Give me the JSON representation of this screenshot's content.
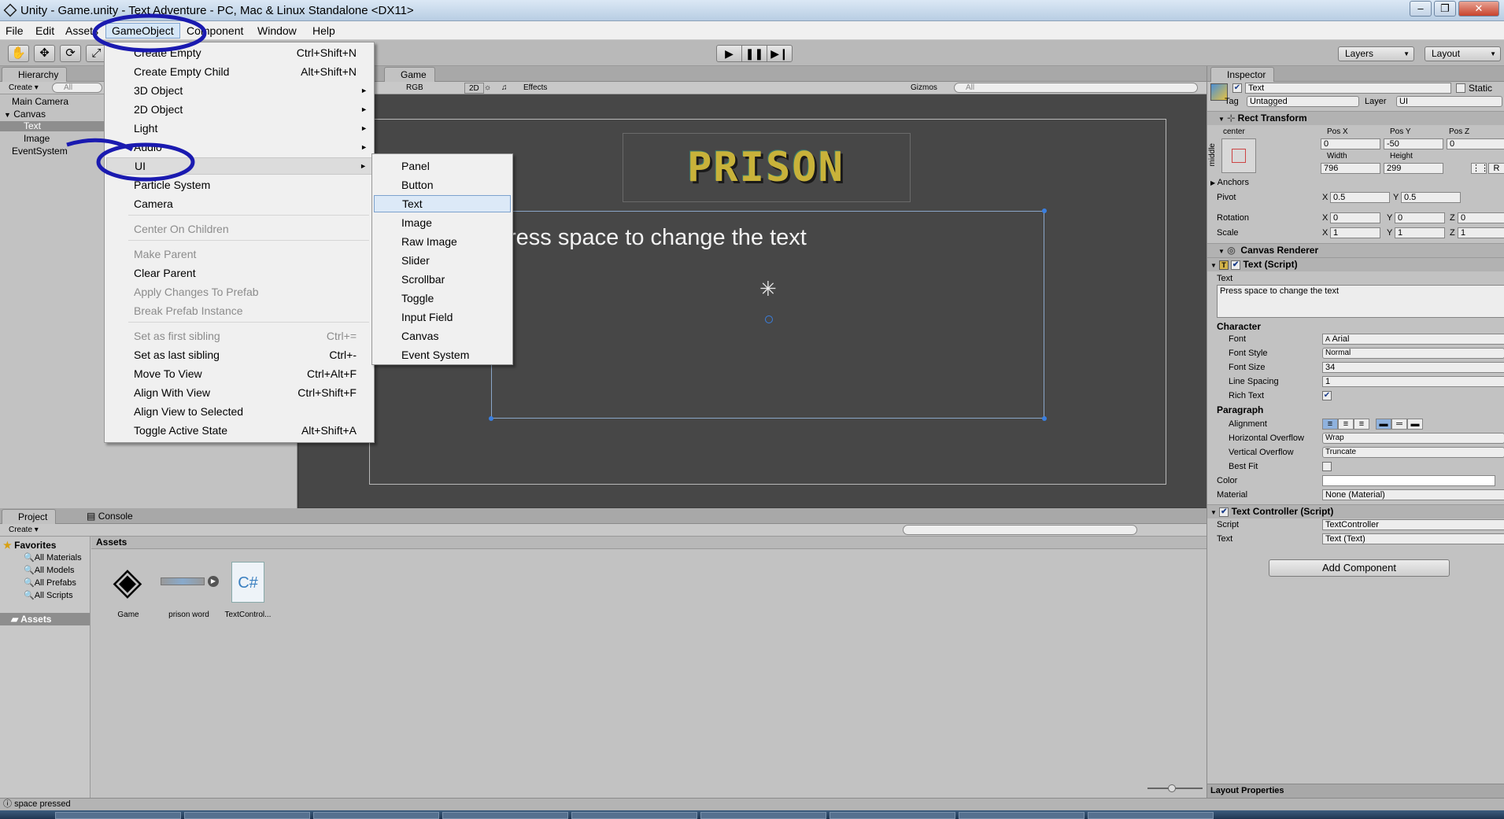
{
  "window": {
    "title": "Unity - Game.unity - Text Adventure - PC, Mac & Linux Standalone <DX11>",
    "minimize": "–",
    "maximize": "❐",
    "close": "✕"
  },
  "menubar": [
    "File",
    "Edit",
    "Assets",
    "GameObject",
    "Component",
    "Window",
    "Help"
  ],
  "toolbar": {
    "tools": [
      "✋",
      "✥",
      "⟳",
      "⤢"
    ],
    "play": "▶",
    "pause": "❚❚",
    "step": "▶❙",
    "layers": "Layers",
    "layout": "Layout"
  },
  "hierarchy": {
    "tab": "Hierarchy",
    "create": "Create",
    "search": "All",
    "items": [
      "Main Camera",
      "Canvas",
      "Text",
      "Image",
      "EventSystem"
    ]
  },
  "game": {
    "tab": "Game",
    "rgb": "RGB",
    "mode2d": "2D",
    "effects": "Effects",
    "gizmos": "Gizmos",
    "search": "All",
    "logo": "PRISON",
    "text": "ress space to change the text"
  },
  "gameobject_menu": [
    {
      "label": "Create Empty",
      "shortcut": "Ctrl+Shift+N"
    },
    {
      "label": "Create Empty Child",
      "shortcut": "Alt+Shift+N"
    },
    {
      "label": "3D Object",
      "arrow": "►"
    },
    {
      "label": "2D Object",
      "arrow": "►"
    },
    {
      "label": "Light",
      "arrow": "►"
    },
    {
      "label": "Audio",
      "arrow": "►"
    },
    {
      "label": "UI",
      "arrow": "►"
    },
    {
      "label": "Particle System"
    },
    {
      "label": "Camera"
    },
    {
      "label": "Center On Children",
      "disabled": true
    },
    {
      "label": "Make Parent",
      "disabled": true
    },
    {
      "label": "Clear Parent"
    },
    {
      "label": "Apply Changes To Prefab",
      "disabled": true
    },
    {
      "label": "Break Prefab Instance",
      "disabled": true
    },
    {
      "label": "Set as first sibling",
      "shortcut": "Ctrl+=",
      "disabled": true
    },
    {
      "label": "Set as last sibling",
      "shortcut": "Ctrl+-"
    },
    {
      "label": "Move To View",
      "shortcut": "Ctrl+Alt+F"
    },
    {
      "label": "Align With View",
      "shortcut": "Ctrl+Shift+F"
    },
    {
      "label": "Align View to Selected"
    },
    {
      "label": "Toggle Active State",
      "shortcut": "Alt+Shift+A"
    }
  ],
  "ui_submenu": [
    "Panel",
    "Button",
    "Text",
    "Image",
    "Raw Image",
    "Slider",
    "Scrollbar",
    "Toggle",
    "Input Field",
    "Canvas",
    "Event System"
  ],
  "inspector": {
    "tab": "Inspector",
    "name": "Text",
    "static": "Static",
    "tag_label": "Tag",
    "tag": "Untagged",
    "layer_label": "Layer",
    "layer": "UI",
    "rect": {
      "title": "Rect Transform",
      "anchor_h": "center",
      "anchor_v": "middle",
      "posx_label": "Pos X",
      "posy_label": "Pos Y",
      "posz_label": "Pos Z",
      "posx": "0",
      "posy": "-50",
      "posz": "0",
      "width_label": "Width",
      "height_label": "Height",
      "width": "796",
      "height": "299",
      "btn_r": "R",
      "anchors": "Anchors",
      "pivot": "Pivot",
      "pivot_x": "0.5",
      "pivot_y": "0.5",
      "rotation": "Rotation",
      "rot_x": "0",
      "rot_y": "0",
      "rot_z": "0",
      "scale": "Scale",
      "scale_x": "1",
      "scale_y": "1",
      "scale_z": "1",
      "x": "X",
      "y": "Y",
      "z": "Z"
    },
    "canvas_renderer": "Canvas Renderer",
    "text_script": {
      "title": "Text (Script)",
      "text_label": "Text",
      "text": "Press space to change the text",
      "character": "Character",
      "font_label": "Font",
      "font": "Arial",
      "font_style_label": "Font Style",
      "font_style": "Normal",
      "font_size_label": "Font Size",
      "font_size": "34",
      "line_spacing_label": "Line Spacing",
      "line_spacing": "1",
      "rich_text_label": "Rich Text",
      "paragraph": "Paragraph",
      "alignment_label": "Alignment",
      "h_overflow_label": "Horizontal Overflow",
      "h_overflow": "Wrap",
      "v_overflow_label": "Vertical Overflow",
      "v_overflow": "Truncate",
      "best_fit_label": "Best Fit",
      "color_label": "Color",
      "material_label": "Material",
      "material": "None (Material)"
    },
    "controller": {
      "title": "Text Controller (Script)",
      "script_label": "Script",
      "script": "TextController",
      "text_label": "Text",
      "text": "Text (Text)"
    },
    "add_component": "Add Component",
    "layout_properties": "Layout Properties"
  },
  "project": {
    "tab": "Project",
    "console": "Console",
    "create": "Create",
    "favorites": "Favorites",
    "fav_items": [
      "All Materials",
      "All Models",
      "All Prefabs",
      "All Scripts"
    ],
    "assets_root": "Assets",
    "assets_header": "Assets",
    "assets": [
      "Game",
      "prison word",
      "TextControl..."
    ]
  },
  "status": "space pressed"
}
